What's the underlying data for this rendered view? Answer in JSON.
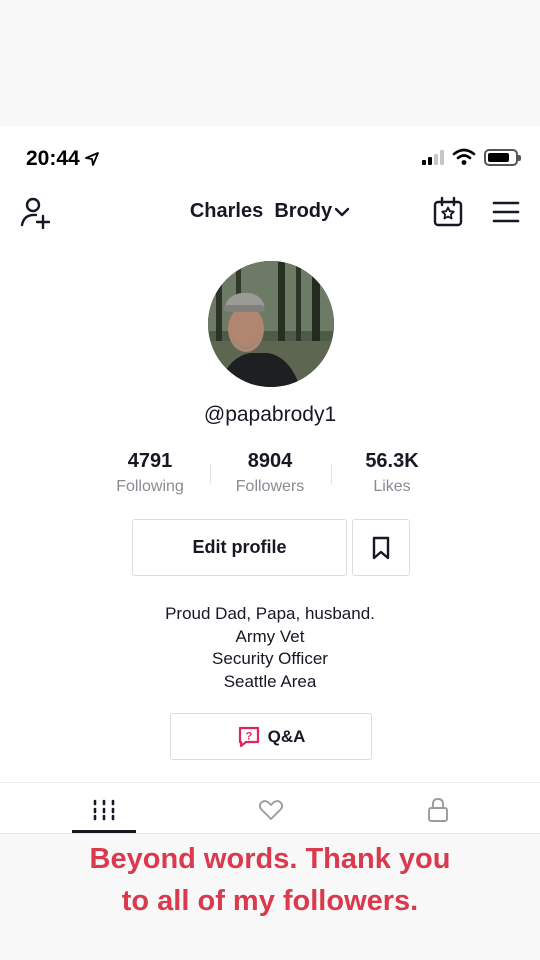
{
  "status_bar": {
    "time": "20:44"
  },
  "header": {
    "title": "Charles  Brody"
  },
  "profile": {
    "handle": "@papabrody1",
    "stats": [
      {
        "value": "4791",
        "label": "Following"
      },
      {
        "value": "8904",
        "label": "Followers"
      },
      {
        "value": "56.3K",
        "label": "Likes"
      }
    ],
    "edit_label": "Edit profile",
    "bio": [
      "Proud Dad, Papa, husband.",
      "Army Vet",
      "Security Officer",
      "Seattle Area"
    ],
    "qa_label": "Q&A"
  },
  "tabs": [
    {
      "icon": "grid-icon",
      "active": true
    },
    {
      "icon": "heart-icon",
      "active": false
    },
    {
      "icon": "lock-icon",
      "active": false
    }
  ],
  "caption": [
    "Beyond words. Thank you",
    "to all of my followers."
  ],
  "colors": {
    "caption": "#d93a4d",
    "qa_icon": "#e0245e",
    "text": "#161823",
    "secondary": "#8a8b91"
  }
}
